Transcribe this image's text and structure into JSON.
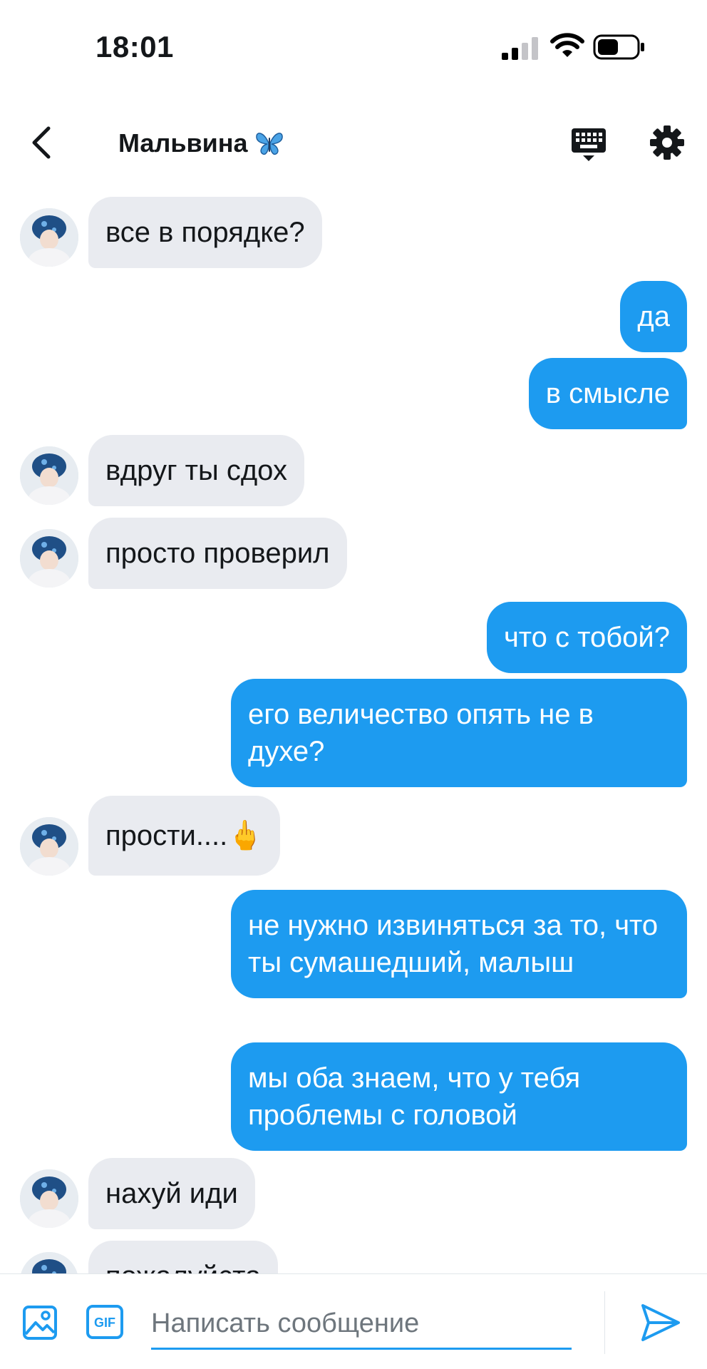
{
  "status_bar": {
    "time": "18:01"
  },
  "header": {
    "title": "Мальвина",
    "title_emoji_icon": "butterfly-icon",
    "back_icon": "chevron-left-icon",
    "keyboard_icon": "keyboard-icon",
    "settings_icon": "gear-icon"
  },
  "colors": {
    "accent": "#1d9bf0",
    "incoming_bubble": "#e9ebf0",
    "text": "#14171a",
    "placeholder": "#6e767d"
  },
  "messages": [
    {
      "direction": "in",
      "text": "все в порядке?"
    },
    {
      "direction": "out",
      "text": "да"
    },
    {
      "direction": "out",
      "text": "в смысле"
    },
    {
      "direction": "in",
      "text": "вдруг ты сдох"
    },
    {
      "direction": "in",
      "text": "просто проверил"
    },
    {
      "direction": "out",
      "text": "что с тобой?"
    },
    {
      "direction": "out",
      "text": "его величество опять не в духе?"
    },
    {
      "direction": "in",
      "text": "прости....🖕"
    },
    {
      "direction": "out",
      "text": "не нужно извиняться за то, что ты сумашедший, малыш"
    },
    {
      "direction": "out",
      "text": "мы оба знаем, что у тебя проблемы с головой"
    },
    {
      "direction": "in",
      "text": "нахуй иди"
    },
    {
      "direction": "in",
      "text": "пожалуйста"
    }
  ],
  "composer": {
    "placeholder": "Написать сообщение",
    "gif_label": "GIF",
    "image_icon": "image-icon",
    "send_icon": "send-icon"
  }
}
